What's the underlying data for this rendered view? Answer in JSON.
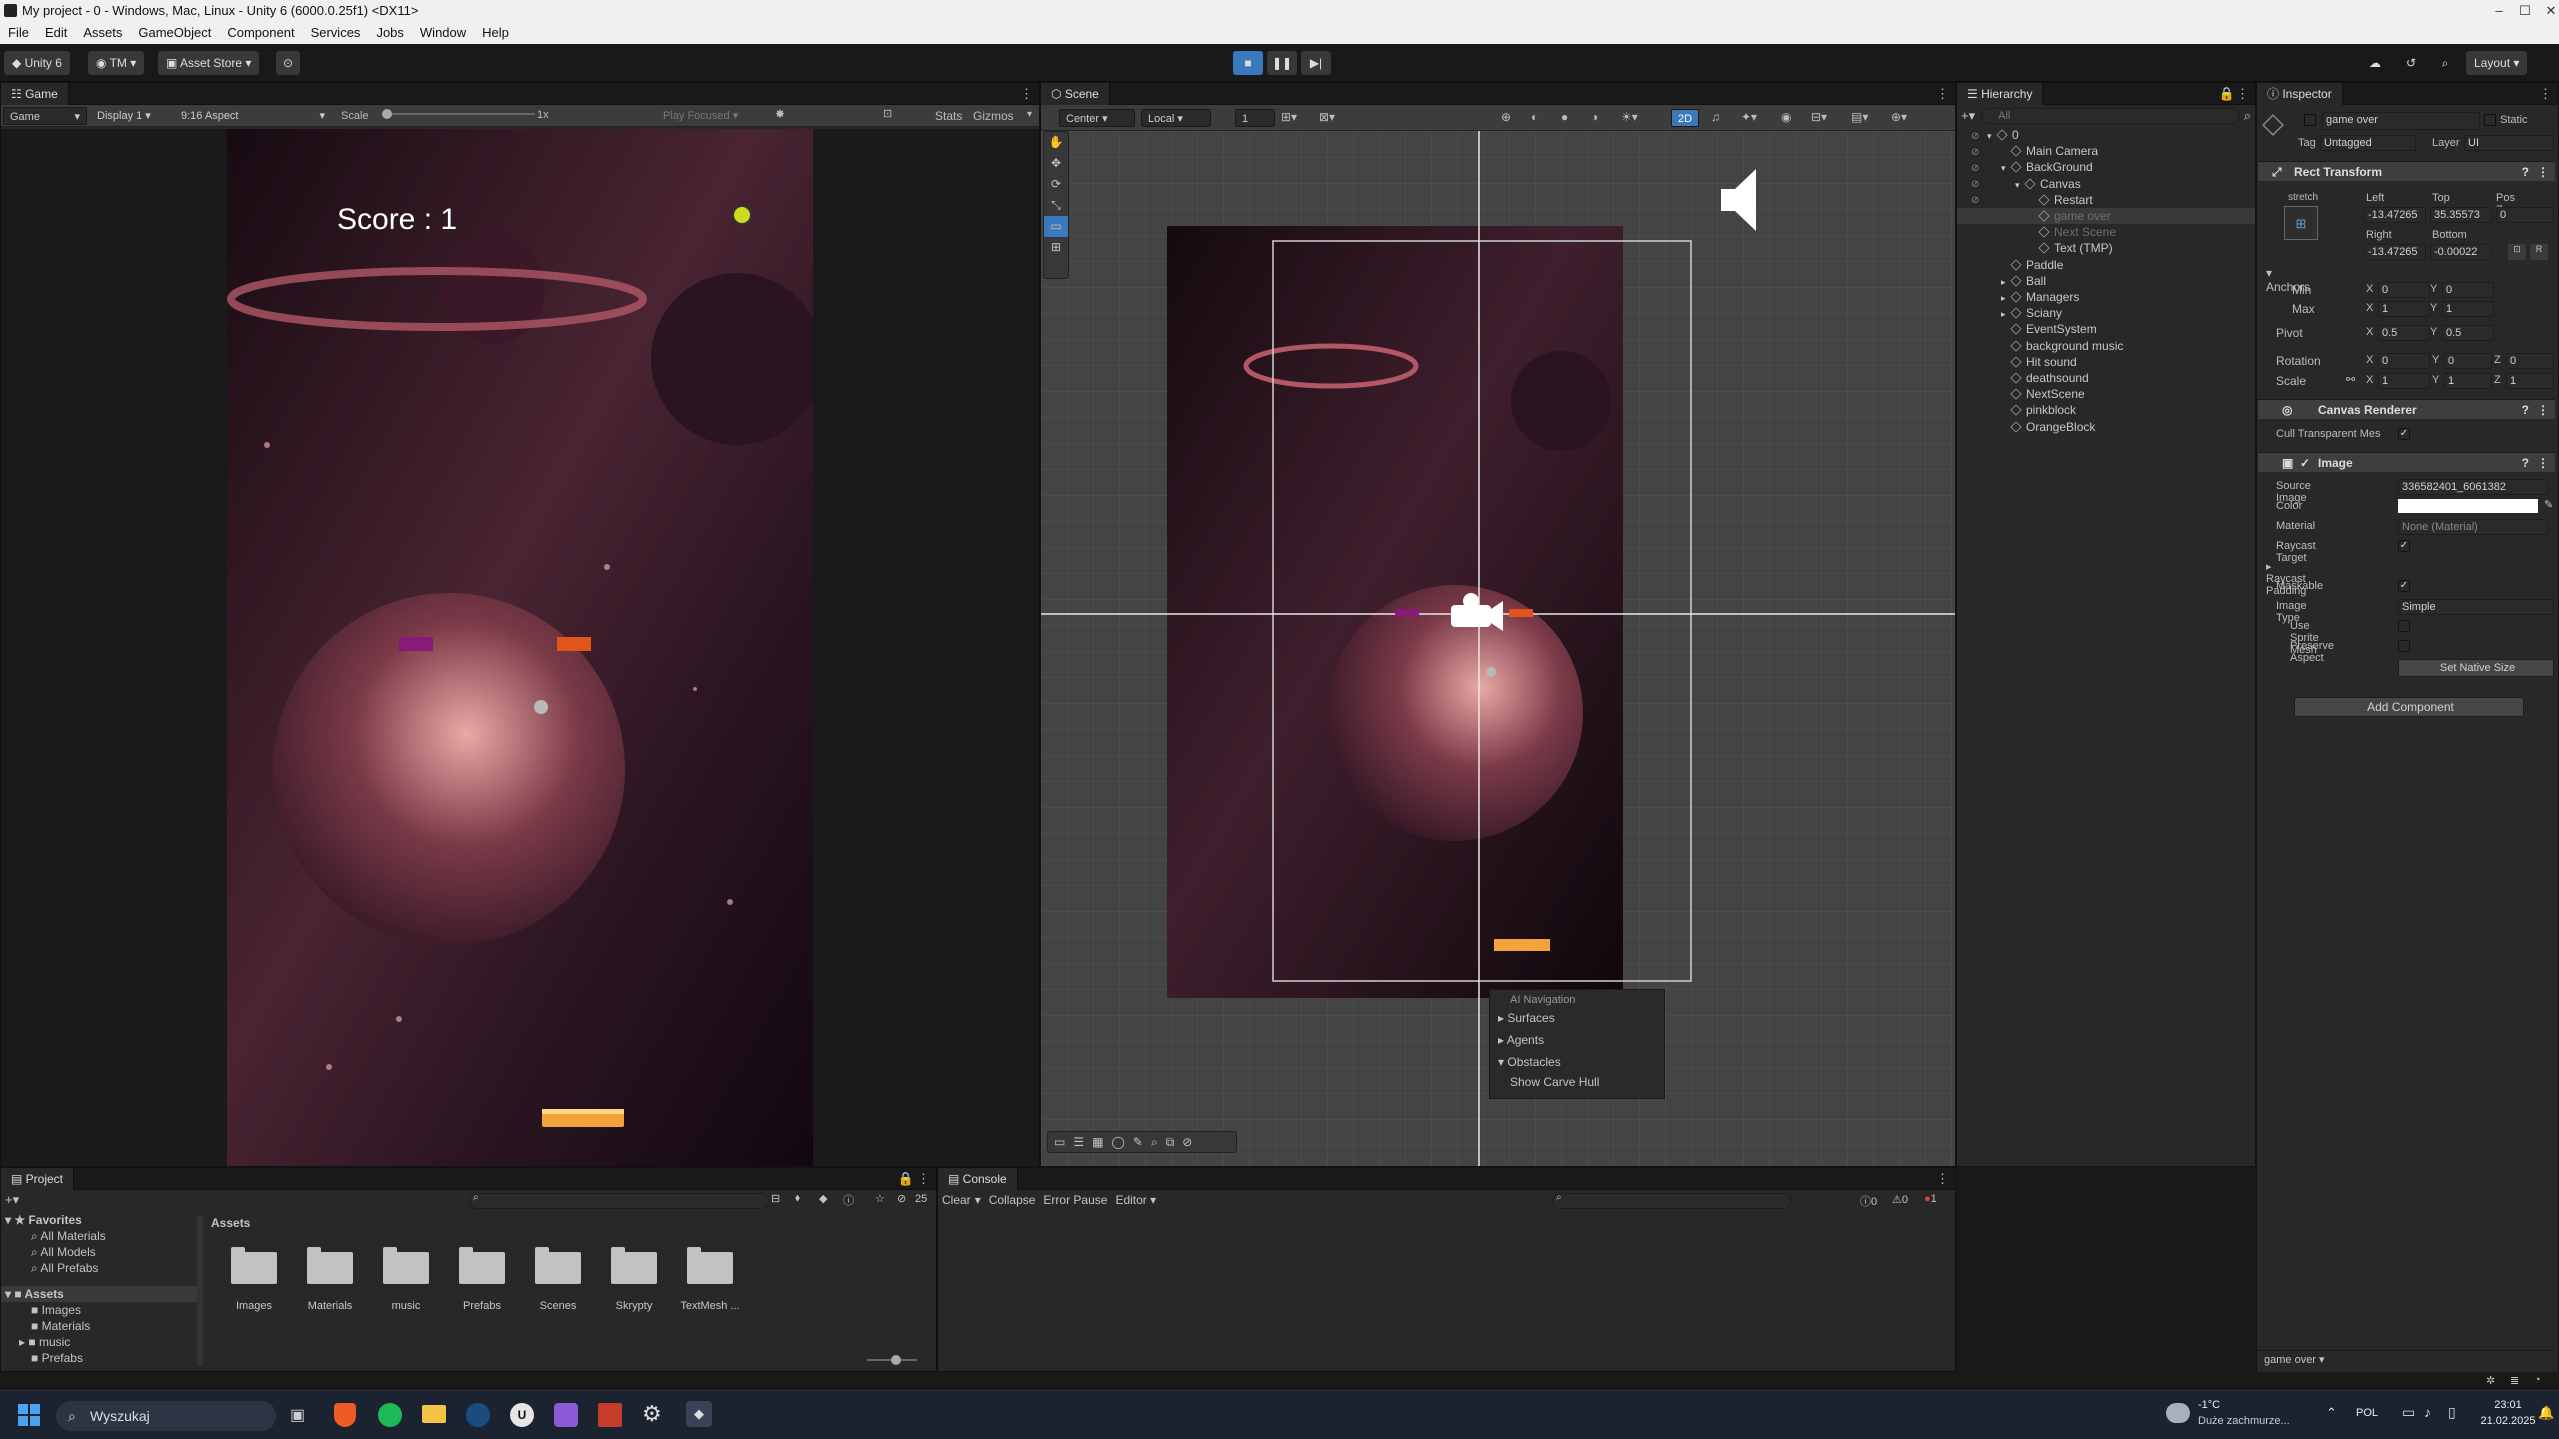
{
  "window": {
    "title": "My project - 0 - Windows, Mac, Linux - Unity 6 (6000.0.25f1) <DX11>"
  },
  "menu": [
    "File",
    "Edit",
    "Assets",
    "GameObject",
    "Component",
    "Services",
    "Jobs",
    "Window",
    "Help"
  ],
  "toolbar": {
    "account": "Unity 6",
    "user": "TM",
    "asset_store": "Asset Store",
    "layout": "Layout"
  },
  "game": {
    "tab": "Game",
    "mode": "Game",
    "display": "Display 1",
    "aspect": "9:16 Aspect",
    "scale_label": "Scale",
    "scale_value": "1x",
    "play_focused": "Play Focused",
    "stats": "Stats",
    "gizmos": "Gizmos",
    "score_text": "Score : 1"
  },
  "scene": {
    "tab": "Scene",
    "pivot": "Center",
    "space": "Local",
    "grid_value": "1",
    "mode_2d": "2D",
    "ai_nav": {
      "title": "AI Navigation",
      "items": [
        "Surfaces",
        "Agents",
        "Obstacles"
      ],
      "show_carve": "Show Carve Hull"
    }
  },
  "hierarchy": {
    "tab": "Hierarchy",
    "search": "All",
    "items": [
      {
        "label": "0",
        "indent": 0
      },
      {
        "label": "Main Camera",
        "indent": 1
      },
      {
        "label": "BackGround",
        "indent": 1
      },
      {
        "label": "Canvas",
        "indent": 2
      },
      {
        "label": "Restart",
        "indent": 3
      },
      {
        "label": "game over",
        "indent": 3,
        "dim": true
      },
      {
        "label": "Next Scene",
        "indent": 3,
        "dim": true
      },
      {
        "label": "Text (TMP)",
        "indent": 3
      },
      {
        "label": "Paddle",
        "indent": 1
      },
      {
        "label": "Ball",
        "indent": 1
      },
      {
        "label": "Managers",
        "indent": 1
      },
      {
        "label": "Sciany",
        "indent": 1
      },
      {
        "label": "EventSystem",
        "indent": 1
      },
      {
        "label": "background music",
        "indent": 1
      },
      {
        "label": "Hit sound",
        "indent": 1
      },
      {
        "label": "deathsound",
        "indent": 1
      },
      {
        "label": "NextScene",
        "indent": 1
      },
      {
        "label": "pinkblock",
        "indent": 1
      },
      {
        "label": "OrangeBlock",
        "indent": 1
      }
    ]
  },
  "inspector": {
    "tab": "Inspector",
    "name": "game over",
    "static": "Static",
    "tag_label": "Tag",
    "tag": "Untagged",
    "layer_label": "Layer",
    "layer": "UI",
    "rect": {
      "title": "Rect Transform",
      "stretch": "stretch",
      "left_lbl": "Left",
      "top_lbl": "Top",
      "posz_lbl": "Pos Z",
      "left": "-13.47265",
      "top": "35.35573",
      "posz": "0",
      "right_lbl": "Right",
      "bottom_lbl": "Bottom",
      "right": "-13.47265",
      "bottom": "-0.00022",
      "anchors": "Anchors",
      "min": "Min",
      "max": "Max",
      "min_x": "0",
      "min_y": "0",
      "max_x": "1",
      "max_y": "1",
      "pivot": "Pivot",
      "pivot_x": "0.5",
      "pivot_y": "0.5",
      "rotation": "Rotation",
      "rot_x": "0",
      "rot_y": "0",
      "rot_z": "0",
      "scale": "Scale",
      "scale_x": "1",
      "scale_y": "1",
      "scale_z": "1"
    },
    "canvas_renderer": {
      "title": "Canvas Renderer",
      "cull": "Cull Transparent Mes"
    },
    "image": {
      "title": "Image",
      "source_lbl": "Source Image",
      "source": "336582401_6061382",
      "color_lbl": "Color",
      "material_lbl": "Material",
      "material": "None (Material)",
      "raycast": "Raycast Target",
      "padding": "Raycast Padding",
      "maskable": "Maskable",
      "type_lbl": "Image Type",
      "type": "Simple",
      "sprite_mesh": "Use Sprite Mesh",
      "preserve": "Preserve Aspect",
      "native": "Set Native Size"
    },
    "add_component": "Add Component",
    "footer": "game over"
  },
  "project": {
    "tab": "Project",
    "favorites": "Favorites",
    "fav_items": [
      "All Materials",
      "All Models",
      "All Prefabs"
    ],
    "assets": "Assets",
    "asset_tree": [
      "Images",
      "Materials",
      "music",
      "Prefabs"
    ],
    "assets_header": "Assets",
    "count": "25",
    "folders": [
      "Images",
      "Materials",
      "music",
      "Prefabs",
      "Scenes",
      "Skrypty",
      "TextMesh ..."
    ]
  },
  "console": {
    "tab": "Console",
    "clear": "Clear",
    "collapse": "Collapse",
    "error_pause": "Error Pause",
    "editor": "Editor",
    "logs": "0",
    "warnings": "0",
    "errors": "1"
  },
  "taskbar": {
    "search": "Wyszukaj",
    "weather_temp": "-1°C",
    "weather_desc": "Duże zachmurze...",
    "lang": "POL",
    "time": "23:01",
    "date": "21.02.2025"
  },
  "colors": {
    "accent": "#3a79bb",
    "space_dark": "#1a0d15",
    "planet": "#c08080",
    "paddle": "#f2a33a",
    "purple_block": "#8a1a7a",
    "orange_block": "#e3541a"
  }
}
